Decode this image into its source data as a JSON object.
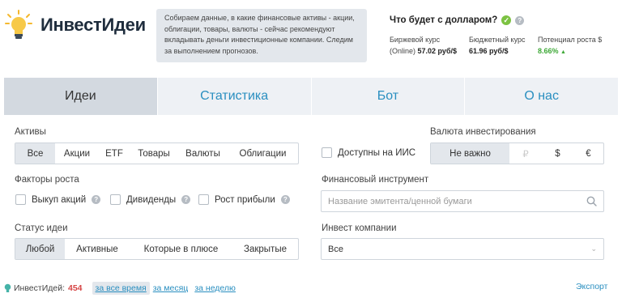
{
  "header": {
    "brand": "ИнвестИдеи",
    "info_text": "Собираем данные, в какие финансовые активы - акции, облигации, товары, валюты - сейчас рекомендуют вкладывать деньги инвестиционные компании. Следим за выполнением прогнозов.",
    "dollar_title": "Что будет с долларом?",
    "rates": {
      "exchange_label_1": "Биржевой курс",
      "exchange_label_2": "(Online)",
      "exchange_value": "57.02 руб/$",
      "budget_label": "Бюджетный курс",
      "budget_value": "61.96 руб/$",
      "potential_label": "Потенциал роста $",
      "potential_value": "8.66%"
    },
    "colors": {
      "brand": "#1f2d3d",
      "accent": "#2a8fc0",
      "green": "#3da836"
    }
  },
  "tabs": [
    {
      "label": "Идеи",
      "active": true
    },
    {
      "label": "Статистика"
    },
    {
      "label": "Бот"
    },
    {
      "label": "О нас"
    }
  ],
  "filters": {
    "assets_label": "Активы",
    "assets": [
      "Все",
      "Акции",
      "ETF",
      "Товары",
      "Валюты",
      "Облигации"
    ],
    "growth_label": "Факторы роста",
    "growth": [
      "Выкуп акций",
      "Дивиденды",
      "Рост прибыли"
    ],
    "status_label": "Статус идеи",
    "status": [
      "Любой",
      "Активные",
      "Которые в плюсе",
      "Закрытые"
    ],
    "iis_label": "Доступны на ИИС",
    "currency_label": "Валюта инвестирования",
    "currency": [
      "Не важно",
      "₽",
      "$",
      "€"
    ],
    "instrument_label": "Финансовый инструмент",
    "instrument_placeholder": "Название эмитента/ценной бумаги",
    "companies_label": "Инвест компании",
    "companies_value": "Все"
  },
  "footer": {
    "ideas_label": "ИнвестИдей:",
    "ideas_count": "454",
    "all_time": "за все время",
    "month": "за месяц",
    "week": "за неделю",
    "export": "Экспорт"
  }
}
